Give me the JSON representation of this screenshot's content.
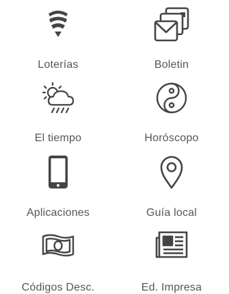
{
  "services": {
    "items": [
      {
        "label": "Loterías",
        "icon": "lottery-icon"
      },
      {
        "label": "Boletin",
        "icon": "newsletter-icon"
      },
      {
        "label": "El tiempo",
        "icon": "weather-icon"
      },
      {
        "label": "Horóscopo",
        "icon": "yin-yang-icon"
      },
      {
        "label": "Aplicaciones",
        "icon": "smartphone-icon"
      },
      {
        "label": "Guía local",
        "icon": "map-pin-icon"
      },
      {
        "label": "Códigos Desc.",
        "icon": "banknote-icon"
      },
      {
        "label": "Ed. Impresa",
        "icon": "newspaper-icon"
      }
    ]
  },
  "colors": {
    "icon_dark": "#444444",
    "icon_outline": "#555555",
    "label": "#555555",
    "background": "#ffffff"
  }
}
